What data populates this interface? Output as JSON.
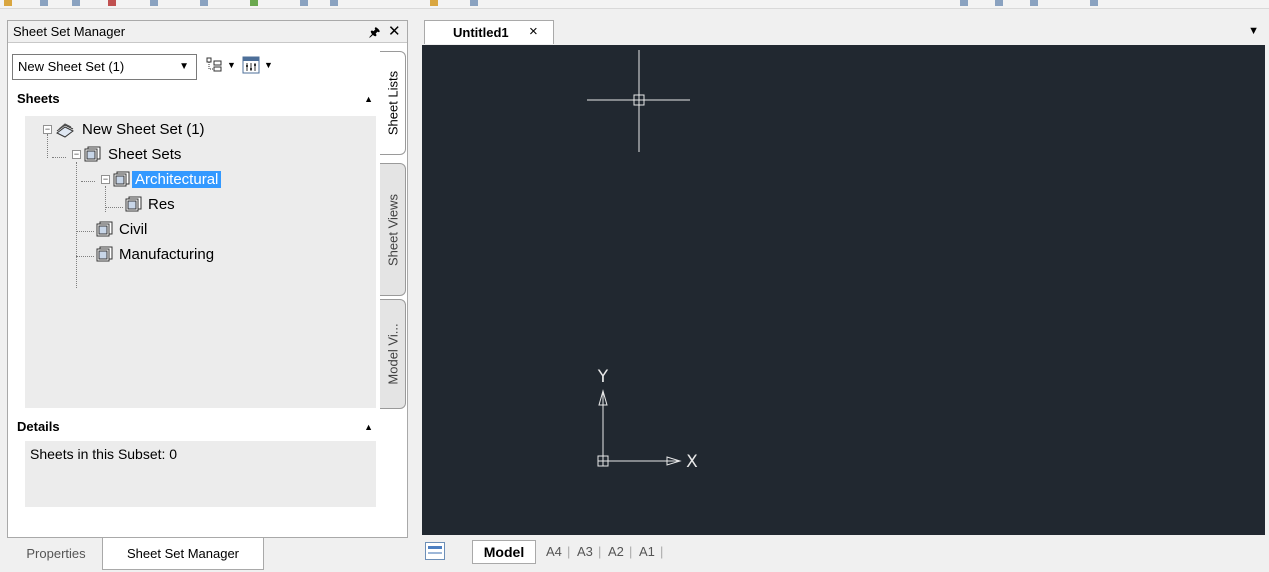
{
  "palette": {
    "title": "Sheet Set Manager",
    "pin_icon": "pin-icon",
    "close_icon": "close-icon",
    "sheet_set_selector": "New Sheet Set (1)",
    "sheets_header": "Sheets",
    "details_header": "Details",
    "details_text": "Sheets in this Subset: 0",
    "tree": [
      {
        "label": "New Sheet Set (1)",
        "icon": "sheet-set-icon",
        "selected": false
      },
      {
        "label": "Sheet Sets",
        "icon": "sheet-subset-icon",
        "selected": false
      },
      {
        "label": "Architectural",
        "icon": "sheet-subset-icon",
        "selected": true
      },
      {
        "label": "Res",
        "icon": "sheet-icon",
        "selected": false
      },
      {
        "label": "Civil",
        "icon": "sheet-icon",
        "selected": false
      },
      {
        "label": "Manufacturing",
        "icon": "sheet-icon",
        "selected": false
      }
    ],
    "vertical_tabs": [
      "Sheet Lists",
      "Sheet Views",
      "Model Vi..."
    ],
    "bottom_tabs": [
      "Properties",
      "Sheet Set Manager"
    ]
  },
  "document": {
    "tab_title": "Untitled1",
    "tab_close": "×",
    "ucs": {
      "y_label": "Y",
      "x_label": "X"
    },
    "layout_tabs": [
      "Model",
      "A4",
      "A3",
      "A2",
      "A1"
    ],
    "canvas_color": "#212830"
  }
}
